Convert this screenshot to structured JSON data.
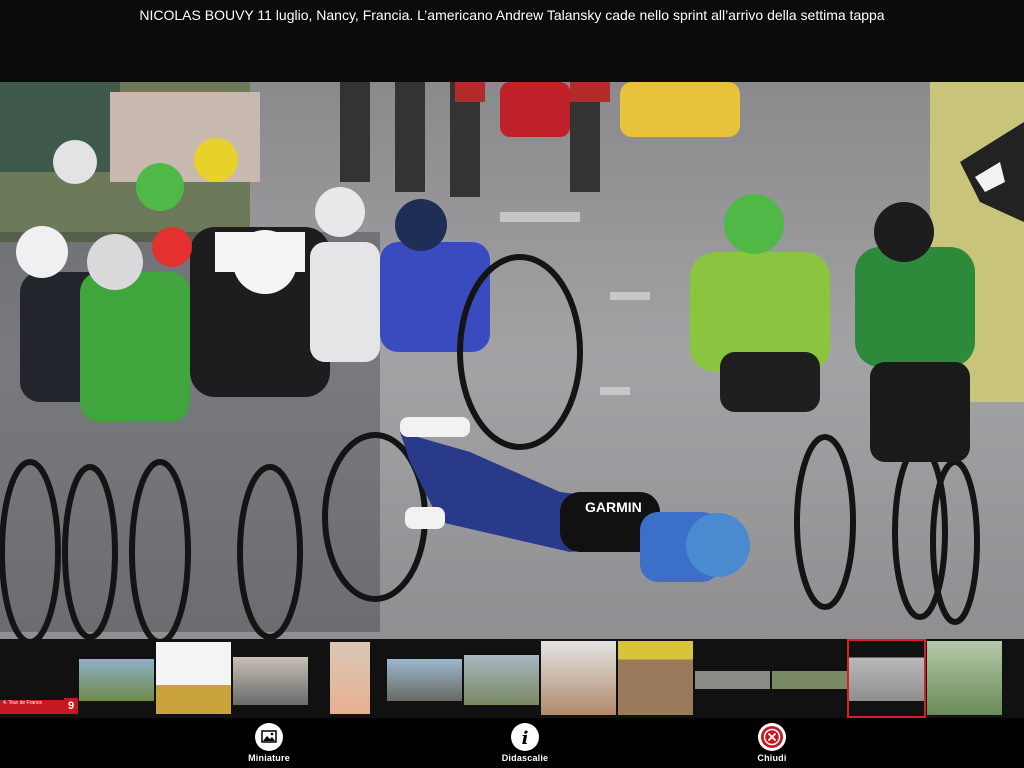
{
  "caption": {
    "text": "NICOLAS BOUVY 11 luglio, Nancy, Francia. L’americano Andrew Talansky cade nello sprint all’arrivo della settima tappa"
  },
  "photo": {
    "jersey_text": "GARMIN"
  },
  "filmstrip": {
    "album_label": "4. Tour de France",
    "album_count": "9",
    "selected_index": 9,
    "thumbnails": [
      {
        "label": "landscape"
      },
      {
        "label": "podium"
      },
      {
        "label": "team"
      },
      {
        "label": "portrait"
      },
      {
        "label": "city"
      },
      {
        "label": "riders"
      },
      {
        "label": "close-up"
      },
      {
        "label": "close-up-2"
      },
      {
        "label": "peloton"
      },
      {
        "label": "crash"
      },
      {
        "label": "sprint"
      }
    ]
  },
  "toolbar": {
    "thumbnails_label": "Miniature",
    "captions_label": "Didascalie",
    "close_label": "Chiudi"
  },
  "colors": {
    "accent_red": "#c8171e",
    "background": "#000000"
  }
}
